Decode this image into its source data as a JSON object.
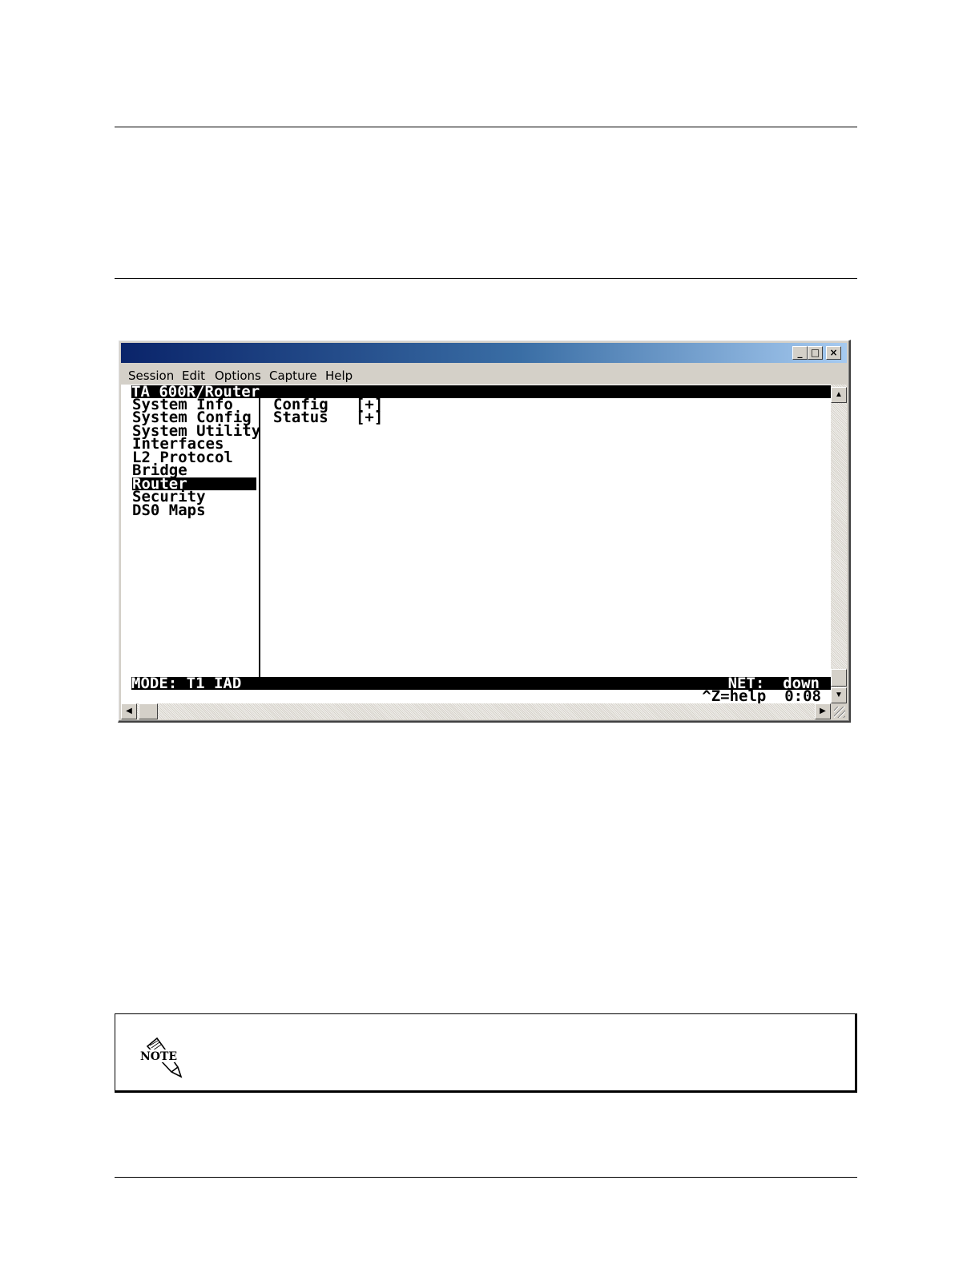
{
  "window": {
    "menu": [
      "Session",
      "Edit",
      "Options",
      "Capture",
      "Help"
    ],
    "buttons": {
      "minimize": "_",
      "maximize": "□",
      "close": "×"
    }
  },
  "terminal": {
    "header": "TA 600R/Router",
    "menu_entries": [
      "System Info",
      "System Config",
      "System Utility",
      "Interfaces",
      "L2 Protocol",
      "Bridge",
      "Router",
      "Security",
      "DS0 Maps"
    ],
    "selected_entry": "Router",
    "sub_items": [
      {
        "label": "Config",
        "marker": "[+]"
      },
      {
        "label": "Status",
        "marker": "[+]"
      }
    ],
    "mode": "MODE: T1 IAD",
    "net_status": "NET:  down",
    "help": "^Z=help  0:08"
  },
  "scrollbar": {
    "up": "▲",
    "down": "▼",
    "left": "◀",
    "right": "▶"
  },
  "note": {
    "icon_label": "NOTE"
  }
}
